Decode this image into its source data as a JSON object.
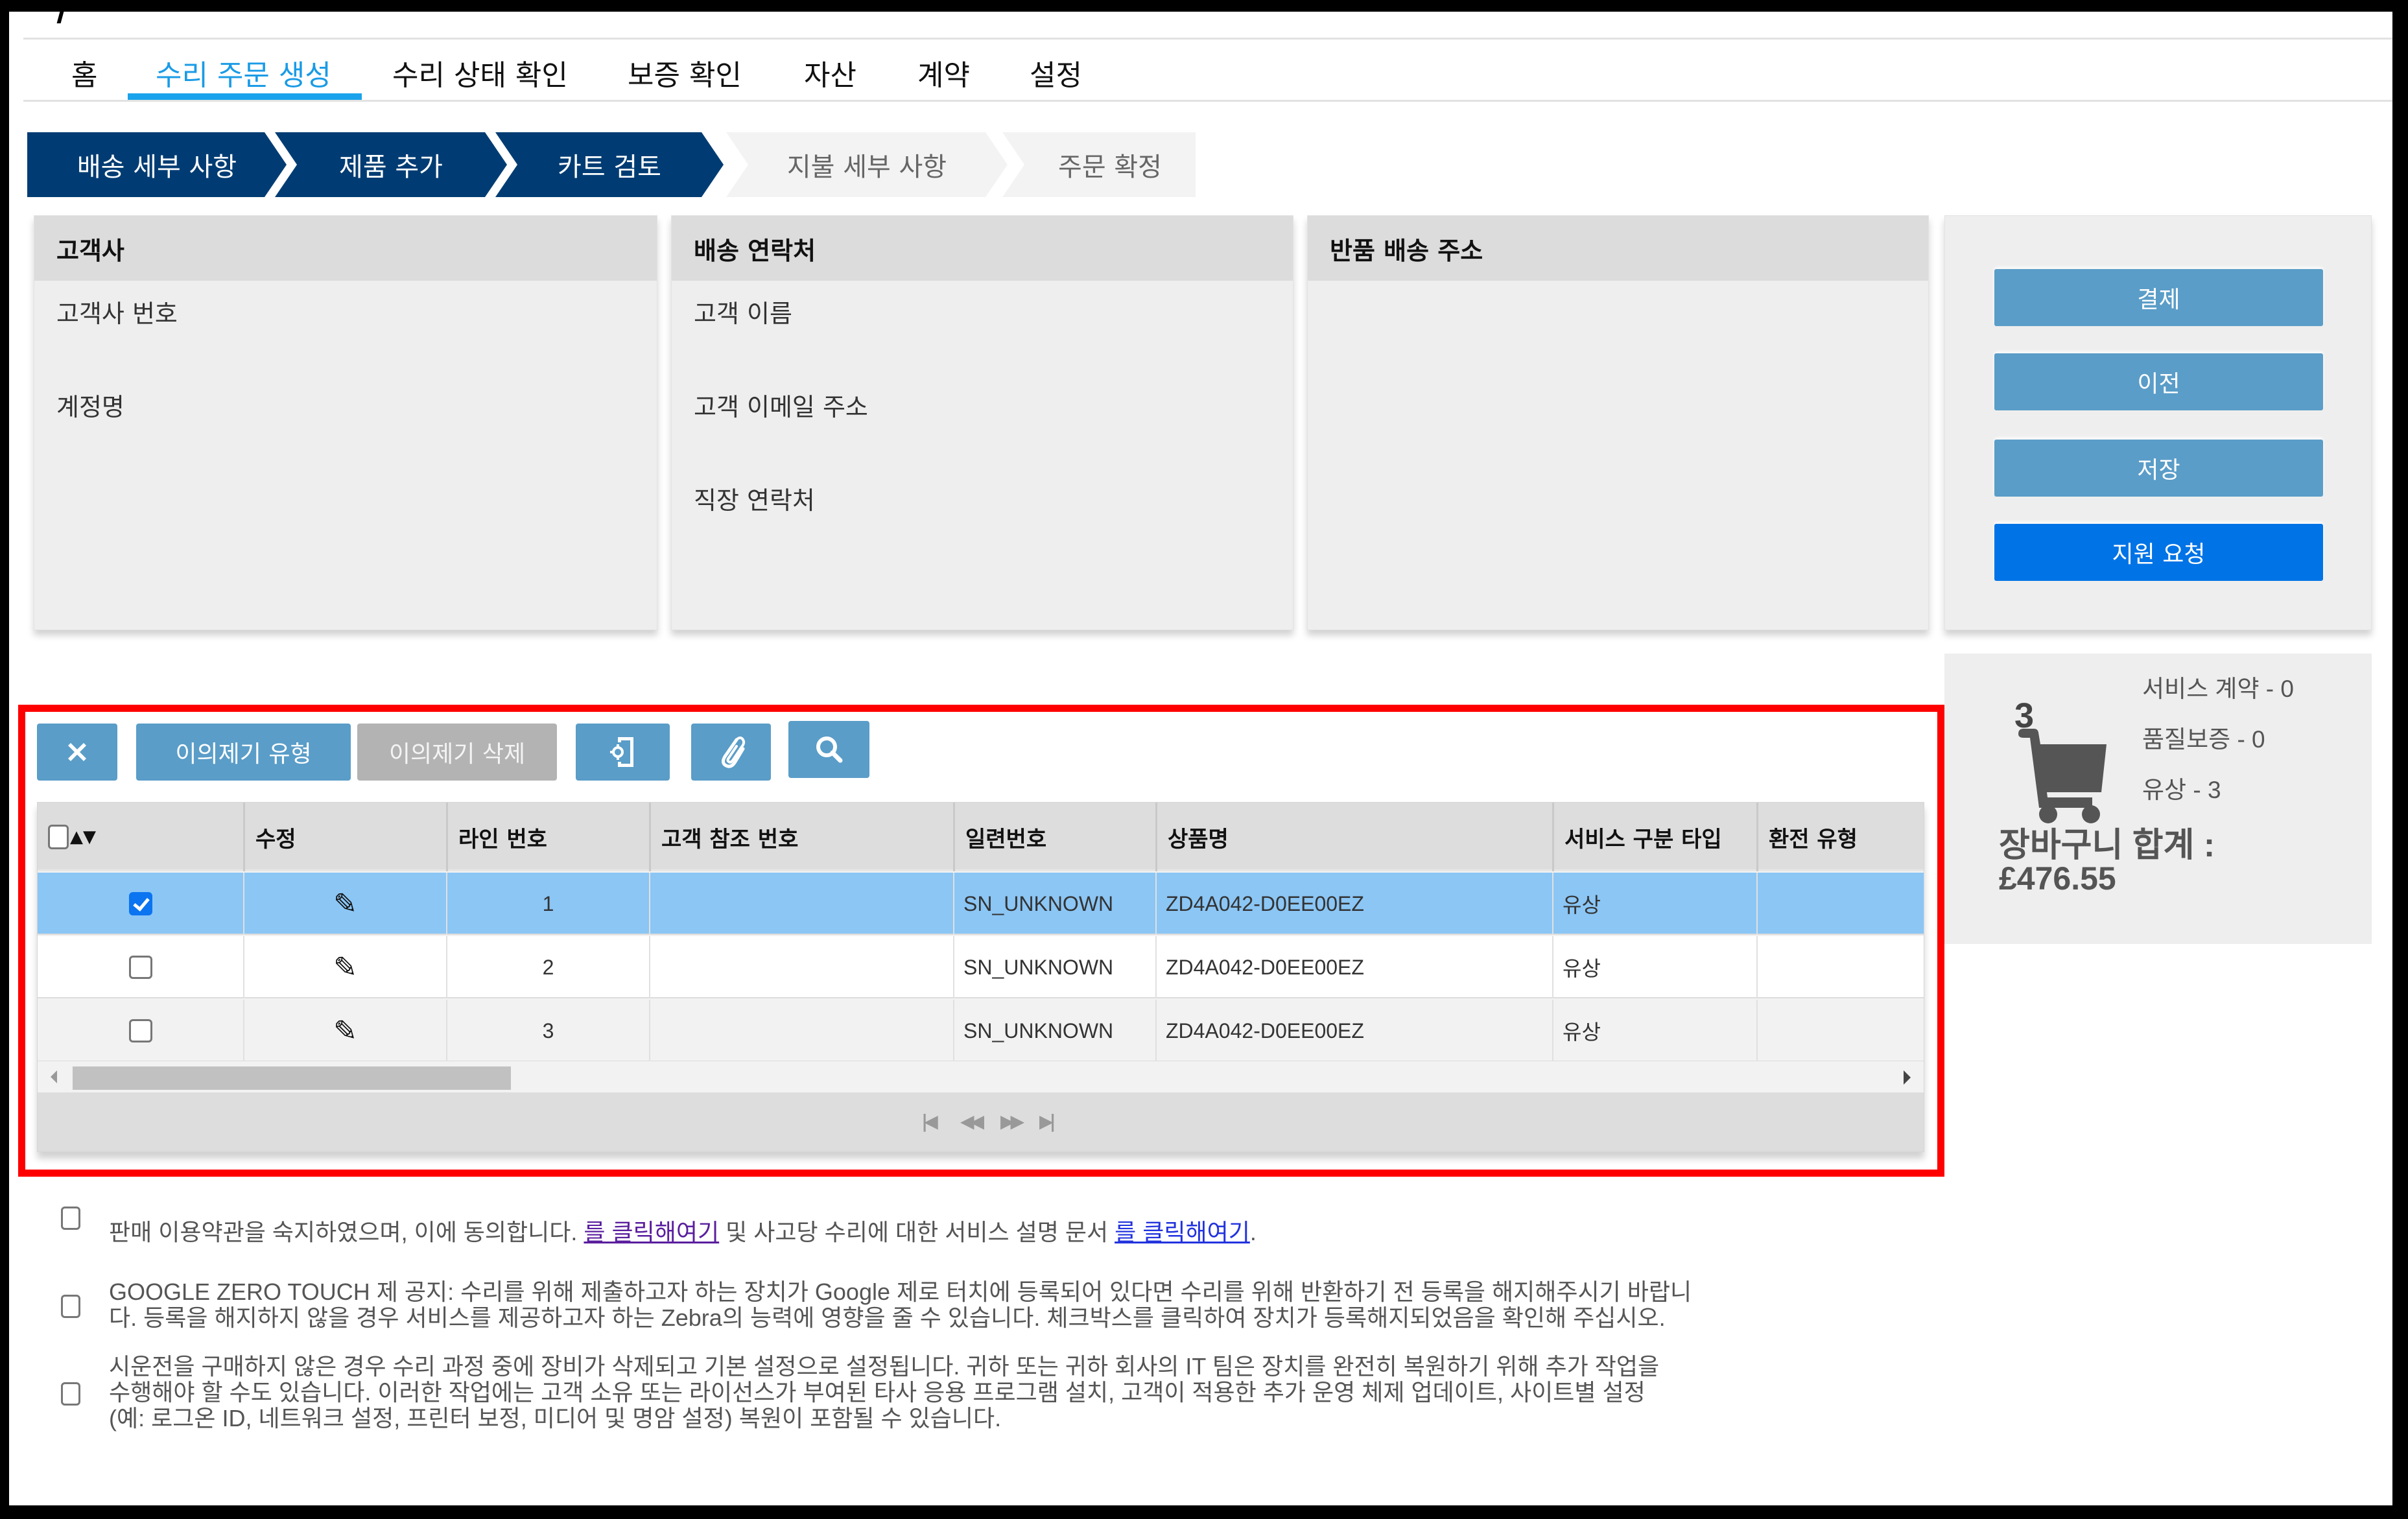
{
  "nav": {
    "items": [
      {
        "label": "홈",
        "active": false
      },
      {
        "label": "수리 주문 생성",
        "active": true
      },
      {
        "label": "수리 상태 확인",
        "active": false
      },
      {
        "label": "보증 확인",
        "active": false
      },
      {
        "label": "자산",
        "active": false
      },
      {
        "label": "계약",
        "active": false
      },
      {
        "label": "설정",
        "active": false
      }
    ]
  },
  "stepper": {
    "steps": [
      {
        "label": "배송 세부 사항",
        "status": "done"
      },
      {
        "label": "제품 추가",
        "status": "done"
      },
      {
        "label": "카트 검토",
        "status": "current"
      },
      {
        "label": "지불 세부 사항",
        "status": "todo"
      },
      {
        "label": "주문 확정",
        "status": "todo"
      }
    ]
  },
  "panels": {
    "customer": {
      "title": "고객사",
      "fields": [
        "고객사 번호",
        "계정명"
      ]
    },
    "shipping_contact": {
      "title": "배송 연락처",
      "fields": [
        "고객 이름",
        "고객 이메일 주소",
        "직장 연락처"
      ]
    },
    "return_address": {
      "title": "반품 배송 주소"
    }
  },
  "actions": {
    "checkout": "결제",
    "previous": "이전",
    "save": "저장",
    "support": "지원 요청"
  },
  "cart": {
    "count": "3",
    "service_contract": "서비스 계약 - 0",
    "warranty": "품질보증 - 0",
    "paid": "유상 - 3",
    "total_label": "장바구니 합계 :",
    "total_value": "£476.55"
  },
  "toolbar": {
    "remove_icon": "close-icon",
    "complaint_type": "이의제기 유형",
    "complaint_delete": "이의제기 삭제",
    "device_settings_icon": "device-settings-icon",
    "attach_icon": "paperclip-icon",
    "search_icon": "search-icon"
  },
  "grid": {
    "columns": [
      "",
      "수정",
      "라인 번호",
      "고객 참조 번호",
      "일련번호",
      "상품명",
      "서비스 구분 타입",
      "환전 유형"
    ],
    "sort_indicator": "▲▼",
    "rows": [
      {
        "checked": true,
        "line": "1",
        "customer_ref": "",
        "serial": "SN_UNKNOWN",
        "product": "ZD4A042-D0EE00EZ",
        "service_type": "유상",
        "exchange_type": ""
      },
      {
        "checked": false,
        "line": "2",
        "customer_ref": "",
        "serial": "SN_UNKNOWN",
        "product": "ZD4A042-D0EE00EZ",
        "service_type": "유상",
        "exchange_type": ""
      },
      {
        "checked": false,
        "line": "3",
        "customer_ref": "",
        "serial": "SN_UNKNOWN",
        "product": "ZD4A042-D0EE00EZ",
        "service_type": "유상",
        "exchange_type": ""
      }
    ],
    "pager": {
      "first": "⏮",
      "prev": "⏪",
      "next": "⏩",
      "last": "⏭"
    }
  },
  "terms": {
    "t1_before": "판매 이용약관을 숙지하였으며, 이에 동의합니다. ",
    "t1_link1": "를 클릭해여기",
    "t1_middle": " 및 사고당 수리에 대한 서비스 설명 문서 ",
    "t1_link2": "를 클릭해여기",
    "t1_after": ".",
    "t2_line1": "GOOGLE ZERO TOUCH 제 공지: 수리를 위해 제출하고자 하는 장치가 Google 제로 터치에 등록되어 있다면 수리를 위해 반환하기 전 등록을 해지해주시기 바랍니",
    "t2_line2": "다. 등록을 해지하지 않을 경우 서비스를 제공하고자 하는 Zebra의 능력에 영향을 줄 수 있습니다. 체크박스를 클릭하여 장치가 등록해지되었음을 확인해 주십시오.",
    "t3_line1": "시운전을 구매하지 않은 경우 수리 과정 중에 장비가 삭제되고 기본 설정으로 설정됩니다. 귀하 또는 귀하 회사의 IT 팀은 장치를 완전히 복원하기 위해 추가 작업을",
    "t3_line2": "수행해야 할 수도 있습니다. 이러한 작업에는 고객 소유 또는 라이선스가 부여된 타사 응용 프로그램 설치, 고객이 적용한 추가 운영 체제 업데이트, 사이트별 설정",
    "t3_line3": "(예: 로그온 ID, 네트워크 설정, 프린터 보정, 미디어 및 명암 설정) 복원이 포함될 수 있습니다."
  },
  "colors": {
    "accent": "#1a9be6",
    "stepper_done": "#003c73",
    "button": "#5a9dc8",
    "button_primary": "#0073e6",
    "row_selected": "#8bc6f5",
    "highlight_frame": "#ff0000"
  }
}
